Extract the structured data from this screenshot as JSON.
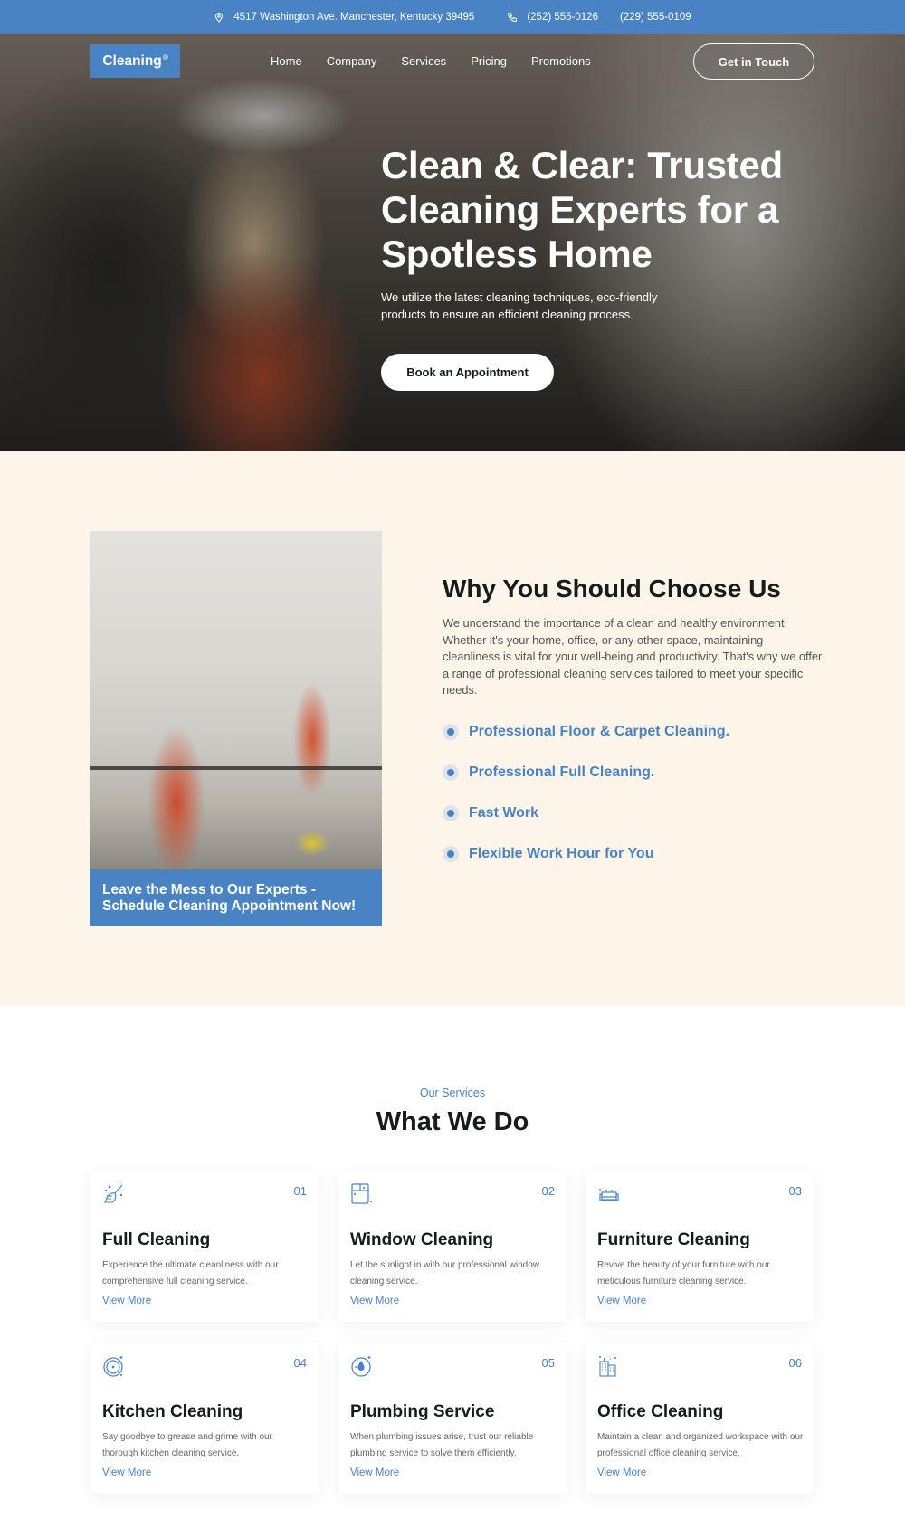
{
  "topbar": {
    "address": "4517 Washington Ave. Manchester, Kentucky 39495",
    "phone_1": "(252) 555-0126",
    "phone_2": "(229) 555-0109",
    "address_icon": "map-pin-icon",
    "phone_icon": "phone-icon"
  },
  "nav": {
    "logo": "Cleaning",
    "logo_mark": "®",
    "items": [
      {
        "label": "Home"
      },
      {
        "label": "Company"
      },
      {
        "label": "Services"
      },
      {
        "label": "Pricing"
      },
      {
        "label": "Promotions"
      }
    ],
    "cta": "Get in Touch"
  },
  "hero": {
    "title": "Clean & Clear: Trusted Cleaning Experts for a Spotless Home",
    "subtitle": "We utilize the latest cleaning techniques, eco-friendly products to ensure an efficient cleaning process.",
    "button": "Book an Appointment"
  },
  "why": {
    "image_caption": "Leave the Mess to Our Experts - Schedule Cleaning Appointment Now!",
    "title": "Why You Should Choose Us",
    "paragraph": "We understand the importance of a clean and healthy environment. Whether it's your home, office, or any other space, maintaining cleanliness is vital for your well-being and productivity. That's why we offer a range of professional cleaning services tailored to meet your specific needs.",
    "features": [
      {
        "label": "Professional Floor & Carpet Cleaning."
      },
      {
        "label": "Professional Full Cleaning."
      },
      {
        "label": "Fast Work"
      },
      {
        "label": "Flexible Work Hour for You"
      }
    ]
  },
  "services": {
    "kicker": "Our Services",
    "title": "What We Do",
    "cards": [
      {
        "number": "01",
        "title": "Full Cleaning",
        "description": "Experience the ultimate cleanliness with our comprehensive full cleaning service.",
        "link": "View More",
        "icon": "broom-sparkle-icon"
      },
      {
        "number": "02",
        "title": "Window Cleaning",
        "description": "Let the sunlight in with our professional window cleaning service.",
        "link": "View More",
        "icon": "window-icon"
      },
      {
        "number": "03",
        "title": "Furniture Cleaning",
        "description": "Revive the beauty of your furniture with our meticulous furniture cleaning service.",
        "link": "View More",
        "icon": "sofa-icon"
      },
      {
        "number": "04",
        "title": "Kitchen Cleaning",
        "description": "Say goodbye to grease and grime with our thorough kitchen cleaning service.",
        "link": "View More",
        "icon": "plate-icon"
      },
      {
        "number": "05",
        "title": "Plumbing Service",
        "description": "When plumbing issues arise, trust our reliable plumbing service to solve them efficiently.",
        "link": "View More",
        "icon": "water-drop-icon"
      },
      {
        "number": "06",
        "title": "Office Cleaning",
        "description": "Maintain a clean and organized workspace with our professional office cleaning service.",
        "link": "View More",
        "icon": "office-building-icon"
      }
    ]
  },
  "colors": {
    "accent": "#4a83c4",
    "cream_bg": "#fef5ea",
    "heading": "#161c1c"
  }
}
